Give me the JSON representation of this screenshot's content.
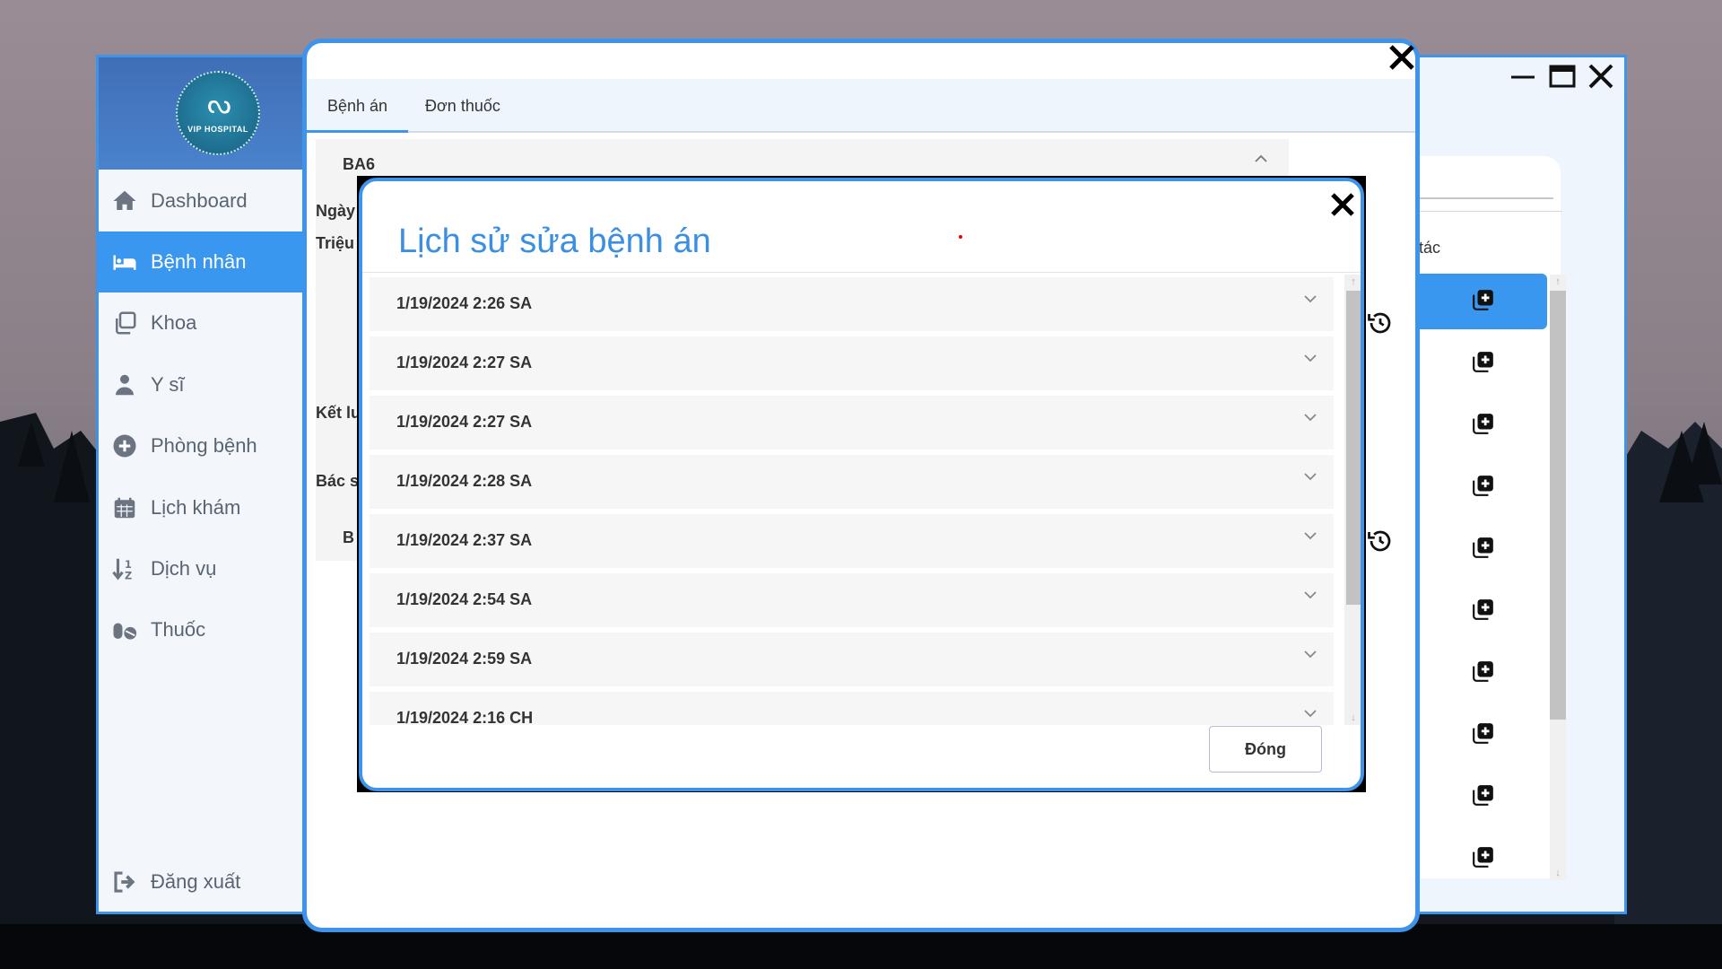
{
  "app": {
    "logo_text": "VIP HOSPITAL"
  },
  "sidebar": {
    "items": [
      {
        "label": "Dashboard",
        "icon": "home-icon"
      },
      {
        "label": "Bệnh nhân",
        "icon": "bed-icon",
        "active": true
      },
      {
        "label": "Khoa",
        "icon": "copy-icon"
      },
      {
        "label": "Y sĩ",
        "icon": "doctor-icon"
      },
      {
        "label": "Phòng bệnh",
        "icon": "plus-circle-icon"
      },
      {
        "label": "Lịch khám",
        "icon": "calendar-icon"
      },
      {
        "label": "Dịch vụ",
        "icon": "sort-icon"
      },
      {
        "label": "Thuốc",
        "icon": "pills-icon"
      }
    ],
    "logout": {
      "label": "Đăng xuất",
      "icon": "logout-icon"
    }
  },
  "main_window": {
    "controls": [
      "minimize-icon",
      "maximize-icon",
      "close-icon"
    ],
    "right_column_label": "tác"
  },
  "detail_window": {
    "tabs": [
      {
        "label": "Bệnh án",
        "active": true
      },
      {
        "label": "Đơn thuốc"
      }
    ],
    "card_title": "BA6",
    "labels": {
      "date": "Ngày",
      "symptom": "Triệu",
      "conclusion": "Kết lu",
      "doctor": "Bác sĩ",
      "next_card": "B"
    }
  },
  "dialog": {
    "title": "Lịch sử sửa bệnh án",
    "history": [
      "1/19/2024 2:26 SA",
      "1/19/2024 2:27 SA",
      "1/19/2024 2:27 SA",
      "1/19/2024 2:28 SA",
      "1/19/2024 2:37 SA",
      "1/19/2024 2:54 SA",
      "1/19/2024 2:59 SA",
      "1/19/2024 2:16 CH"
    ],
    "close_button": "Đóng"
  },
  "colors": {
    "accent": "#3d94ea",
    "title": "#3a8fe3",
    "active_nav": "#3a97ef"
  }
}
